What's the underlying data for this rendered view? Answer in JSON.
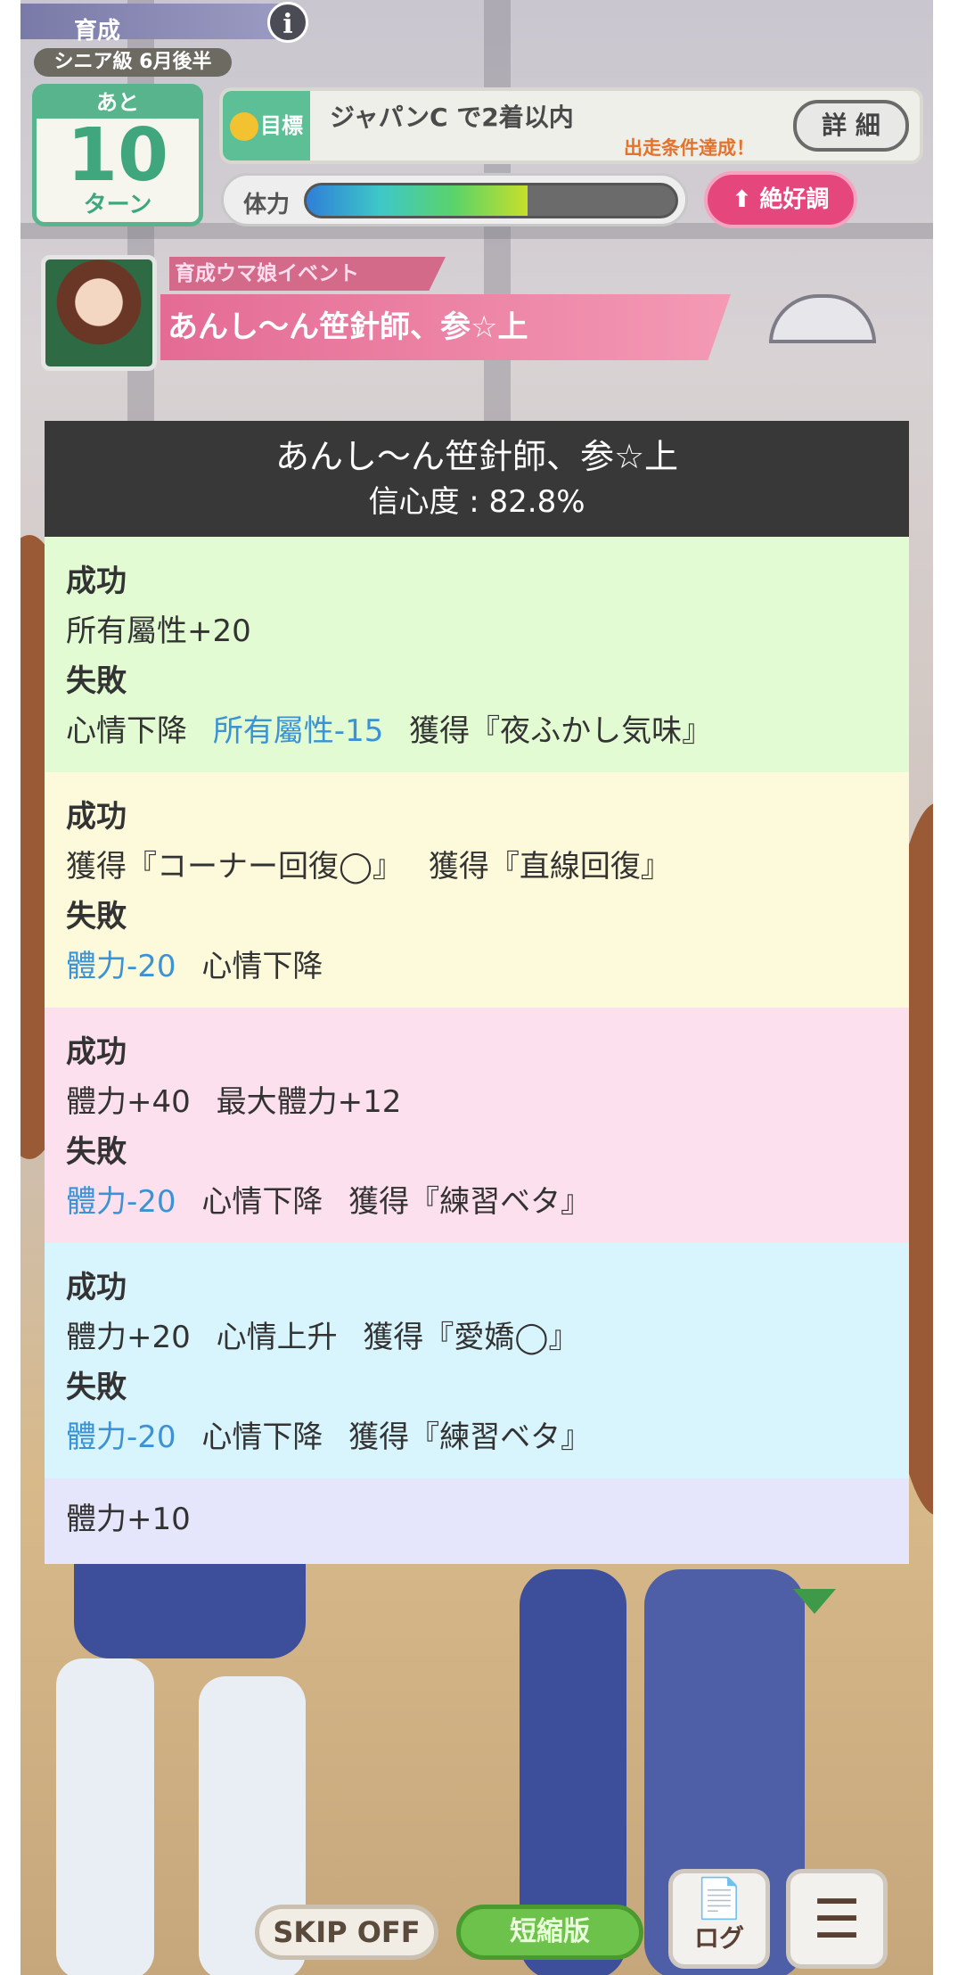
{
  "hud": {
    "mode_title": "育成",
    "info_icon": "i",
    "season": "シニア級 6月後半",
    "turns": {
      "label_top": "あと",
      "count": "10",
      "label_bottom": "ターン"
    },
    "goal": {
      "tag": "目標",
      "text": "ジャパンC で2着以内",
      "status": "出走条件達成！",
      "detail_button": "詳 細"
    },
    "stamina": {
      "label": "体力",
      "fill_percent": 60
    },
    "mood_button": "絶好調"
  },
  "event": {
    "type_label": "育成ウマ娘イベント",
    "title": "あんし〜ん笹針師、参☆上"
  },
  "overlay": {
    "title": "あんし〜ん笹針師、参☆上",
    "confidence": "信心度 : 82.8%",
    "choices": [
      {
        "success_label": "成功",
        "success": "所有屬性+20",
        "fail_label": "失敗",
        "fail": [
          "心情下降",
          "所有屬性-15",
          "獲得『夜ふかし気味』"
        ]
      },
      {
        "success_label": "成功",
        "success": [
          "獲得『コーナー回復◯』",
          "獲得『直線回復』"
        ],
        "fail_label": "失敗",
        "fail": [
          "體力-20",
          "心情下降"
        ]
      },
      {
        "success_label": "成功",
        "success": [
          "體力+40",
          "最大體力+12"
        ],
        "fail_label": "失敗",
        "fail": [
          "體力-20",
          "心情下降",
          "獲得『練習ベタ』"
        ]
      },
      {
        "success_label": "成功",
        "success": [
          "體力+20",
          "心情上升",
          "獲得『愛嬌◯』"
        ],
        "fail_label": "失敗",
        "fail": [
          "體力-20",
          "心情下降",
          "獲得『練習ベタ』"
        ]
      },
      {
        "text": "體力+10"
      }
    ]
  },
  "controls": {
    "skip": "SKIP OFF",
    "short": "短縮版",
    "log": "ログ",
    "log_icon": "log-icon",
    "menu_icon": "menu-icon"
  },
  "colors": {
    "negative": "#3b93d5",
    "choice1": "#e2fbd3",
    "choice2": "#fdfadb",
    "choice3": "#fde0ee",
    "choice4": "#d8f4fc",
    "choice5": "#e5e5fb"
  }
}
